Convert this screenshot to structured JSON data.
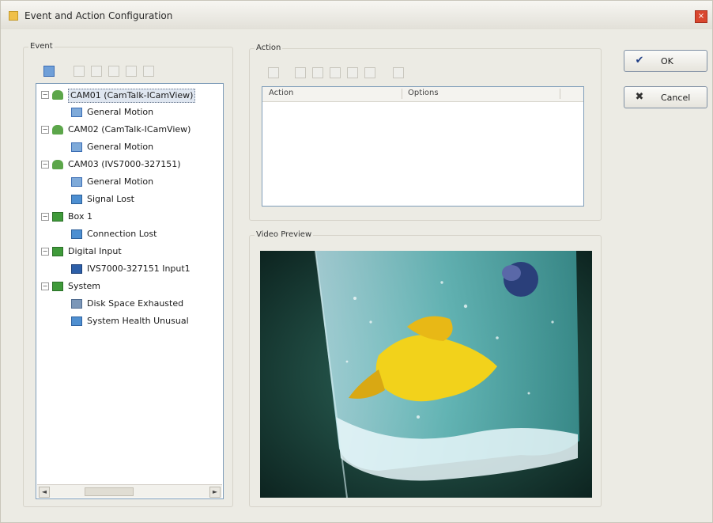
{
  "window": {
    "title": "Event and Action Configuration",
    "close_glyph": "×"
  },
  "event_panel": {
    "label": "Event",
    "toolbar_icons": [
      "select-icon",
      "add-icon",
      "edit-icon",
      "delete-icon",
      "copy-icon",
      "paste-icon"
    ],
    "tree": [
      {
        "label": "CAM01 (CamTalk-ICamView)",
        "icon": "camera-icon",
        "level": 0,
        "expander": "−",
        "selected": true
      },
      {
        "label": "General Motion",
        "icon": "motion-icon",
        "level": 1
      },
      {
        "label": "CAM02 (CamTalk-ICamView)",
        "icon": "camera-icon",
        "level": 0,
        "expander": "−"
      },
      {
        "label": "General Motion",
        "icon": "motion-icon",
        "level": 1
      },
      {
        "label": "CAM03 (IVS7000-327151)",
        "icon": "camera-icon",
        "level": 0,
        "expander": "−"
      },
      {
        "label": "General Motion",
        "icon": "motion-icon",
        "level": 1
      },
      {
        "label": "Signal Lost",
        "icon": "signal-icon",
        "level": 1
      },
      {
        "label": "Box 1",
        "icon": "group-icon",
        "level": 0,
        "expander": "−"
      },
      {
        "label": "Connection Lost",
        "icon": "signal-icon",
        "level": 1
      },
      {
        "label": "Digital Input",
        "icon": "group-icon",
        "level": 0,
        "expander": "−"
      },
      {
        "label": "IVS7000-327151 Input1",
        "icon": "input-icon",
        "level": 1
      },
      {
        "label": "System",
        "icon": "group-icon",
        "level": 0,
        "expander": "−"
      },
      {
        "label": "Disk Space Exhausted",
        "icon": "disk-icon",
        "level": 1
      },
      {
        "label": "System Health Unusual",
        "icon": "health-icon",
        "level": 1
      }
    ],
    "scroll_left": "◄",
    "scroll_right": "►"
  },
  "action_panel": {
    "label": "Action",
    "toolbar_icons": [
      "new-action-icon",
      "add-icon",
      "edit-icon",
      "delete-icon",
      "copy-icon",
      "paste-icon",
      "properties-icon"
    ],
    "columns": [
      "Action",
      "Options"
    ]
  },
  "preview_panel": {
    "label": "Video Preview"
  },
  "buttons": {
    "ok_label": "OK",
    "ok_icon": "✔",
    "cancel_label": "Cancel",
    "cancel_icon": "✖"
  },
  "colors": {
    "window_bg": "#ecebe4",
    "selection": "#dfe6f0",
    "accent": "#3b6db4"
  }
}
